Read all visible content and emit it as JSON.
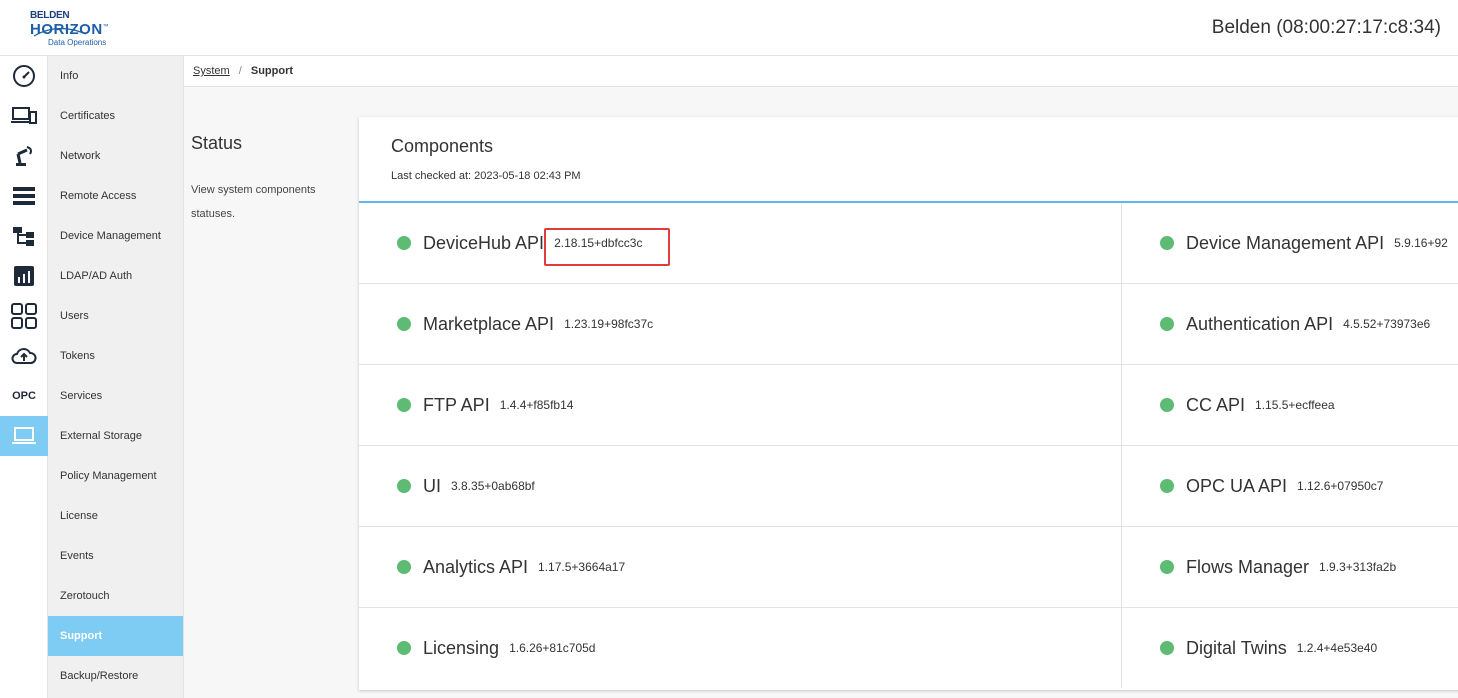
{
  "header": {
    "logo_line1": "BELDEN",
    "logo_line2": "HORIZON",
    "logo_tm": "™",
    "logo_line3": "Data Operations",
    "device_name": "Belden (08:00:27:17:c8:34)"
  },
  "iconbar": {
    "items": [
      {
        "icon": "dashboard-gauge-icon"
      },
      {
        "icon": "devices-icon"
      },
      {
        "icon": "robot-arm-icon"
      },
      {
        "icon": "server-list-icon"
      },
      {
        "icon": "hierarchy-icon"
      },
      {
        "icon": "analytics-chart-icon"
      },
      {
        "icon": "apps-grid-icon"
      },
      {
        "icon": "cloud-upload-icon"
      },
      {
        "icon": "opc-icon",
        "label": "OPC"
      },
      {
        "icon": "laptop-icon",
        "active": true
      }
    ]
  },
  "subnav": {
    "items": [
      {
        "label": "Info"
      },
      {
        "label": "Certificates"
      },
      {
        "label": "Network"
      },
      {
        "label": "Remote Access"
      },
      {
        "label": "Device Management"
      },
      {
        "label": "LDAP/AD Auth"
      },
      {
        "label": "Users"
      },
      {
        "label": "Tokens"
      },
      {
        "label": "Services"
      },
      {
        "label": "External Storage"
      },
      {
        "label": "Policy Management"
      },
      {
        "label": "License"
      },
      {
        "label": "Events"
      },
      {
        "label": "Zerotouch"
      },
      {
        "label": "Support",
        "active": true
      },
      {
        "label": "Backup/Restore"
      }
    ]
  },
  "breadcrumb": {
    "parent": "System",
    "separator": "/",
    "current": "Support"
  },
  "status": {
    "title": "Status",
    "description": "View system components statuses."
  },
  "components": {
    "title": "Components",
    "last_checked": "Last checked at: 2023-05-18 02:43 PM",
    "status_color": "#5dbb74",
    "rows": [
      {
        "left": {
          "name": "DeviceHub API",
          "version": "2.18.15+dbfcc3c"
        },
        "right": {
          "name": "Device Management API",
          "version": "5.9.16+92"
        }
      },
      {
        "left": {
          "name": "Marketplace API",
          "version": "1.23.19+98fc37c"
        },
        "right": {
          "name": "Authentication API",
          "version": "4.5.52+73973e6"
        }
      },
      {
        "left": {
          "name": "FTP API",
          "version": "1.4.4+f85fb14"
        },
        "right": {
          "name": "CC API",
          "version": "1.15.5+ecffeea"
        }
      },
      {
        "left": {
          "name": "UI",
          "version": "3.8.35+0ab68bf"
        },
        "right": {
          "name": "OPC UA API",
          "version": "1.12.6+07950c7"
        }
      },
      {
        "left": {
          "name": "Analytics API",
          "version": "1.17.5+3664a17"
        },
        "right": {
          "name": "Flows Manager",
          "version": "1.9.3+313fa2b"
        }
      },
      {
        "left": {
          "name": "Licensing",
          "version": "1.6.26+81c705d"
        },
        "right": {
          "name": "Digital Twins",
          "version": "1.2.4+4e53e40"
        }
      }
    ]
  },
  "colors": {
    "accent": "#7ecbf4",
    "divider": "#5fb8ea",
    "highlight": "#e03c3c"
  }
}
